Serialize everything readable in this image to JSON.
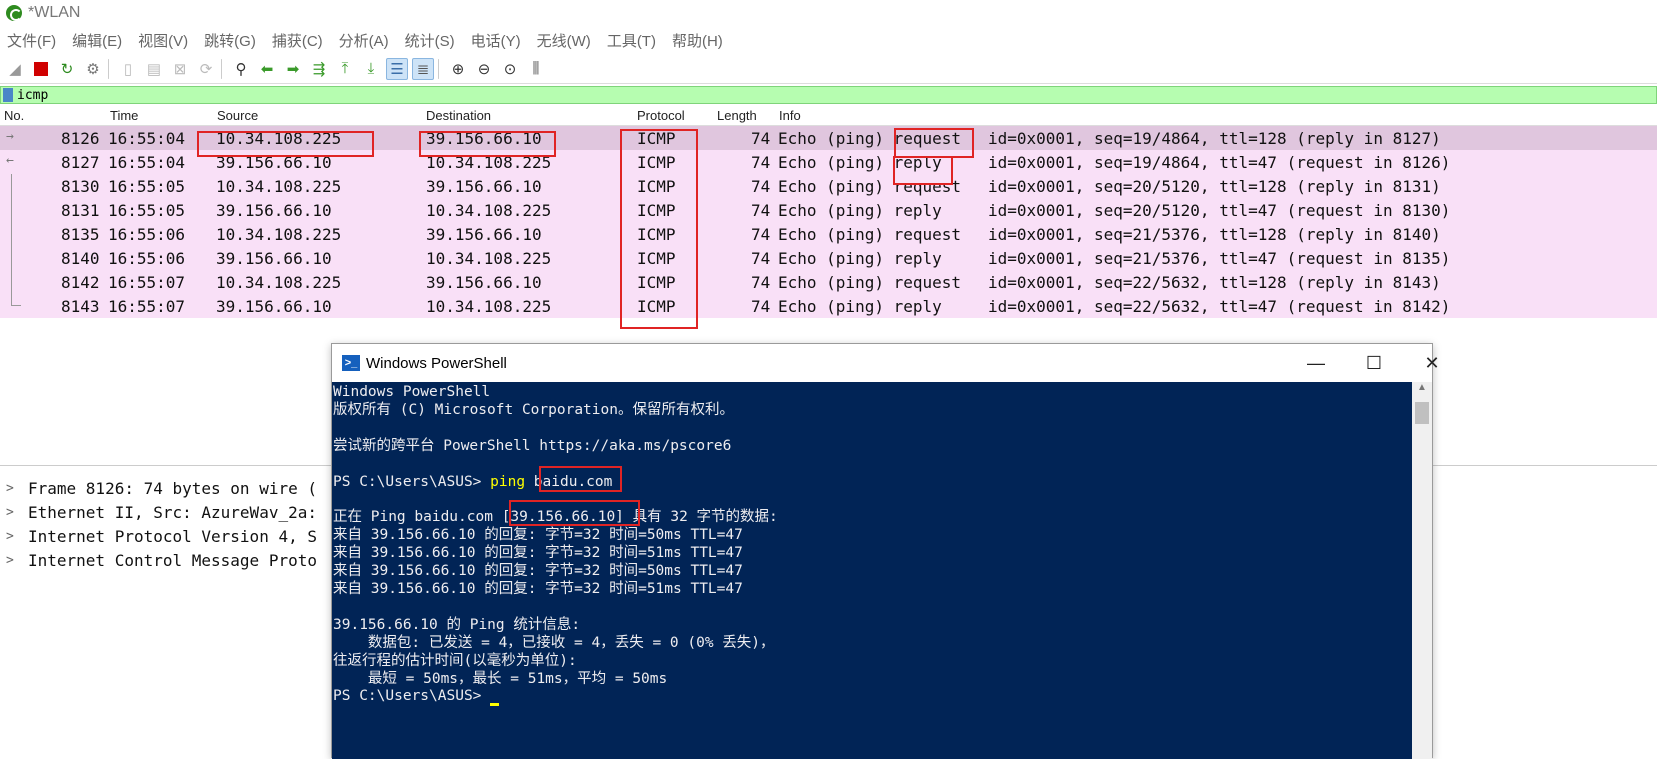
{
  "window_title": "*WLAN",
  "menu": [
    "文件(F)",
    "编辑(E)",
    "视图(V)",
    "跳转(G)",
    "捕获(C)",
    "分析(A)",
    "统计(S)",
    "电话(Y)",
    "无线(W)",
    "工具(T)",
    "帮助(H)"
  ],
  "filter": {
    "value": "icmp"
  },
  "columns": {
    "no": "No.",
    "time": "Time",
    "source": "Source",
    "destination": "Destination",
    "protocol": "Protocol",
    "length": "Length",
    "info": "Info"
  },
  "packets": [
    {
      "no": "8126",
      "time": "16:55:04",
      "src": "10.34.108.225",
      "dst": "39.156.66.10",
      "proto": "ICMP",
      "len": "74",
      "type": "Echo (ping) request",
      "detail": "id=0x0001, seq=19/4864, ttl=128 (reply in 8127)",
      "arrow": "→"
    },
    {
      "no": "8127",
      "time": "16:55:04",
      "src": "39.156.66.10",
      "dst": "10.34.108.225",
      "proto": "ICMP",
      "len": "74",
      "type": "Echo (ping) reply",
      "detail": "id=0x0001, seq=19/4864, ttl=47 (request in 8126)",
      "arrow": "←"
    },
    {
      "no": "8130",
      "time": "16:55:05",
      "src": "10.34.108.225",
      "dst": "39.156.66.10",
      "proto": "ICMP",
      "len": "74",
      "type": "Echo (ping) request",
      "detail": "id=0x0001, seq=20/5120, ttl=128 (reply in 8131)",
      "arrow": ""
    },
    {
      "no": "8131",
      "time": "16:55:05",
      "src": "39.156.66.10",
      "dst": "10.34.108.225",
      "proto": "ICMP",
      "len": "74",
      "type": "Echo (ping) reply",
      "detail": "id=0x0001, seq=20/5120, ttl=47 (request in 8130)",
      "arrow": ""
    },
    {
      "no": "8135",
      "time": "16:55:06",
      "src": "10.34.108.225",
      "dst": "39.156.66.10",
      "proto": "ICMP",
      "len": "74",
      "type": "Echo (ping) request",
      "detail": "id=0x0001, seq=21/5376, ttl=128 (reply in 8140)",
      "arrow": ""
    },
    {
      "no": "8140",
      "time": "16:55:06",
      "src": "39.156.66.10",
      "dst": "10.34.108.225",
      "proto": "ICMP",
      "len": "74",
      "type": "Echo (ping) reply",
      "detail": "id=0x0001, seq=21/5376, ttl=47 (request in 8135)",
      "arrow": ""
    },
    {
      "no": "8142",
      "time": "16:55:07",
      "src": "10.34.108.225",
      "dst": "39.156.66.10",
      "proto": "ICMP",
      "len": "74",
      "type": "Echo (ping) request",
      "detail": "id=0x0001, seq=22/5632, ttl=128 (reply in 8143)",
      "arrow": ""
    },
    {
      "no": "8143",
      "time": "16:55:07",
      "src": "39.156.66.10",
      "dst": "10.34.108.225",
      "proto": "ICMP",
      "len": "74",
      "type": "Echo (ping) reply",
      "detail": "id=0x0001, seq=22/5632, ttl=47 (request in 8142)",
      "arrow": ""
    }
  ],
  "details": [
    "Frame 8126: 74 bytes on wire (",
    "Ethernet II, Src: AzureWav_2a:",
    "Internet Protocol Version 4, S",
    "Internet Control Message Proto"
  ],
  "powershell": {
    "title": "Windows PowerShell",
    "l1": "Windows PowerShell",
    "l2": "版权所有 (C) Microsoft Corporation。保留所有权利。",
    "l3": "尝试新的跨平台 PowerShell https://aka.ms/pscore6",
    "prompt": "PS C:\\Users\\ASUS> ",
    "cmd": "ping",
    "arg": " baidu.com",
    "l5a": "正在 Ping baidu.com ",
    "l5b": "[39.156.66.10]",
    "l5c": " 具有 32 字节的数据:",
    "replies": [
      "来自 39.156.66.10 的回复: 字节=32 时间=50ms TTL=47",
      "来自 39.156.66.10 的回复: 字节=32 时间=51ms TTL=47",
      "来自 39.156.66.10 的回复: 字节=32 时间=50ms TTL=47",
      "来自 39.156.66.10 的回复: 字节=32 时间=51ms TTL=47"
    ],
    "stats1": "39.156.66.10 的 Ping 统计信息:",
    "stats2": "    数据包: 已发送 = 4，已接收 = 4，丢失 = 0 (0% 丢失)，",
    "stats3": "往返行程的估计时间(以毫秒为单位):",
    "stats4": "    最短 = 50ms，最长 = 51ms，平均 = 50ms",
    "prompt2": "PS C:\\Users\\ASUS> "
  },
  "colors": {
    "row_bg": "#f9e0f7",
    "row_selected": "#e0c6de",
    "filter_bg": "#b6fdb0",
    "terminal_bg": "#012456",
    "highlight": "#e02424"
  }
}
